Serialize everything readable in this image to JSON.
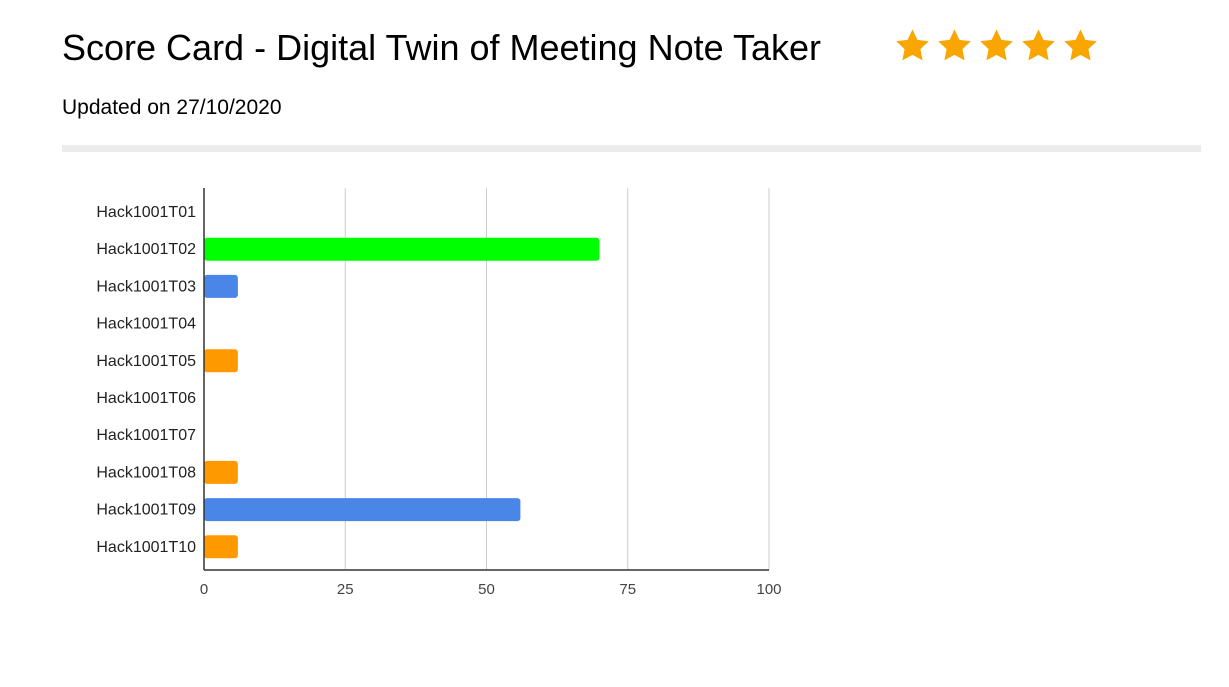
{
  "header": {
    "title": "Score Card - Digital Twin of Meeting Note Taker",
    "updated": "Updated on 27/10/2020",
    "rating": {
      "value": 5,
      "max": 5,
      "icon": "star-icon",
      "color": "#f9a602"
    }
  },
  "chart_data": {
    "type": "bar",
    "orientation": "horizontal",
    "title": "",
    "xlabel": "",
    "ylabel": "",
    "categories": [
      "Hack1001T01",
      "Hack1001T02",
      "Hack1001T03",
      "Hack1001T04",
      "Hack1001T05",
      "Hack1001T06",
      "Hack1001T07",
      "Hack1001T08",
      "Hack1001T09",
      "Hack1001T10"
    ],
    "values": [
      0,
      70,
      6,
      0,
      6,
      0,
      0,
      6,
      56,
      6
    ],
    "colors": [
      "#4a86e8",
      "#00ff00",
      "#4a86e8",
      "#4a86e8",
      "#ff9900",
      "#4a86e8",
      "#4a86e8",
      "#ff9900",
      "#4a86e8",
      "#ff9900"
    ],
    "xlim": [
      0,
      100
    ],
    "xticks": [
      0,
      25,
      50,
      75,
      100
    ],
    "grid": true,
    "legend": "none"
  }
}
